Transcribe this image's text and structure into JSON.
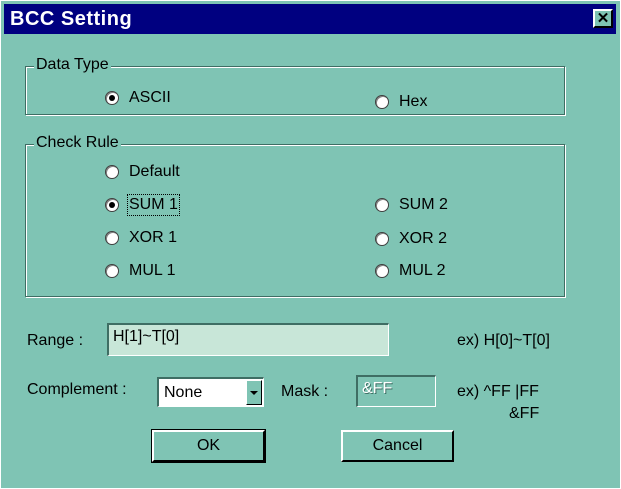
{
  "window": {
    "title": "BCC Setting",
    "close_glyph": "✕"
  },
  "data_type": {
    "label": "Data Type",
    "options": [
      {
        "label": "ASCII",
        "checked": true
      },
      {
        "label": "Hex",
        "checked": false
      }
    ]
  },
  "check_rule": {
    "label": "Check Rule",
    "options": [
      {
        "label": "Default",
        "checked": false
      },
      {
        "label": "SUM 1",
        "checked": true
      },
      {
        "label": "SUM 2",
        "checked": false
      },
      {
        "label": "XOR 1",
        "checked": false
      },
      {
        "label": "XOR 2",
        "checked": false
      },
      {
        "label": "MUL 1",
        "checked": false
      },
      {
        "label": "MUL 2",
        "checked": false
      }
    ]
  },
  "range": {
    "label": "Range :",
    "value": "H[1]~T[0]",
    "example": "ex) H[0]~T[0]"
  },
  "complement": {
    "label": "Complement :",
    "selected": "None"
  },
  "mask": {
    "label": "Mask :",
    "value": "&FF",
    "example_line1": "ex) ^FF  |FF",
    "example_line2": "&FF"
  },
  "buttons": {
    "ok": "OK",
    "cancel": "Cancel"
  },
  "colors": {
    "dialog_bg": "#7fc4b4",
    "titlebar": "#000080",
    "input_bg": "#c8e6d8"
  }
}
